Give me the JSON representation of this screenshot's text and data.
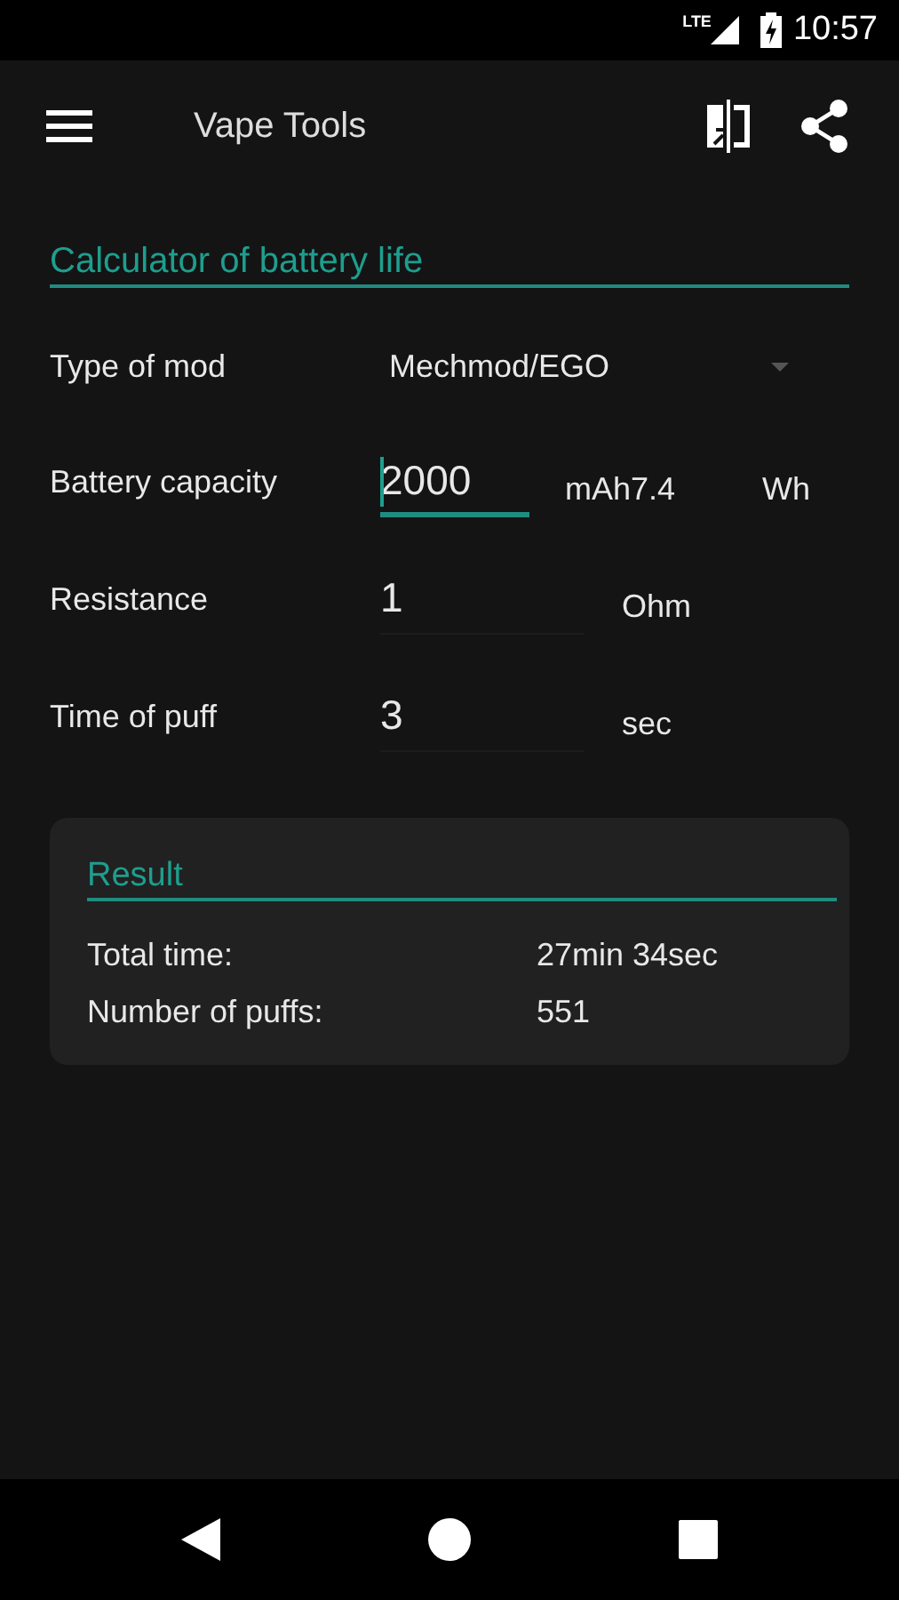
{
  "status_bar": {
    "network": "LTE",
    "time": "10:57"
  },
  "app_bar": {
    "title": "Vape Tools"
  },
  "calculator": {
    "title": "Calculator of battery life",
    "fields": [
      {
        "kind": "dropdown",
        "label": "Type of mod",
        "value": "Mechmod/EGO"
      },
      {
        "kind": "input",
        "label": "Battery capacity",
        "value": "2000",
        "unit": "mAh",
        "focused": true,
        "secondary_value": "7.4",
        "secondary_unit": "Wh"
      },
      {
        "kind": "input",
        "label": "Resistance",
        "value": "1",
        "unit": "Ohm",
        "focused": false
      },
      {
        "kind": "input",
        "label": "Time of puff",
        "value": "3",
        "unit": "sec",
        "focused": false
      }
    ]
  },
  "result": {
    "title": "Result",
    "rows": [
      {
        "label": "Total time:",
        "value": "27min 34sec"
      },
      {
        "label": "Number of puffs:",
        "value": "551"
      }
    ]
  }
}
